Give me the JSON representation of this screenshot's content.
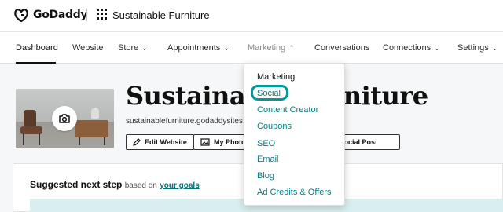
{
  "header": {
    "brand": "GoDaddy",
    "site_name": "Sustainable Furniture"
  },
  "nav": {
    "items": [
      {
        "label": "Dashboard",
        "chevron": ""
      },
      {
        "label": "Website",
        "chevron": ""
      },
      {
        "label": "Store",
        "chevron": "⌄"
      },
      {
        "label": "Appointments",
        "chevron": "⌄"
      },
      {
        "label": "Marketing",
        "chevron": "⌃"
      },
      {
        "label": "Conversations",
        "chevron": ""
      },
      {
        "label": "Connections",
        "chevron": "⌄"
      },
      {
        "label": "Settings",
        "chevron": "⌄"
      }
    ]
  },
  "site": {
    "title": "Sustainable Furniture",
    "url": "sustainablefurniture.godaddysites.com"
  },
  "actions": {
    "edit_website": "Edit Website",
    "my_photos": "My Photos",
    "create_social_post": "Create Social Post"
  },
  "suggestion": {
    "heading": "Suggested next step",
    "based_on": "based on",
    "link": "your goals"
  },
  "marketing_menu": {
    "title": "Marketing",
    "items": [
      "Social",
      "Content Creator",
      "Coupons",
      "SEO",
      "Email",
      "Blog",
      "Ad Credits & Offers"
    ]
  },
  "colors": {
    "accent": "#0b7a80",
    "focus_ring": "#009a9a",
    "band": "#d9eeee"
  }
}
